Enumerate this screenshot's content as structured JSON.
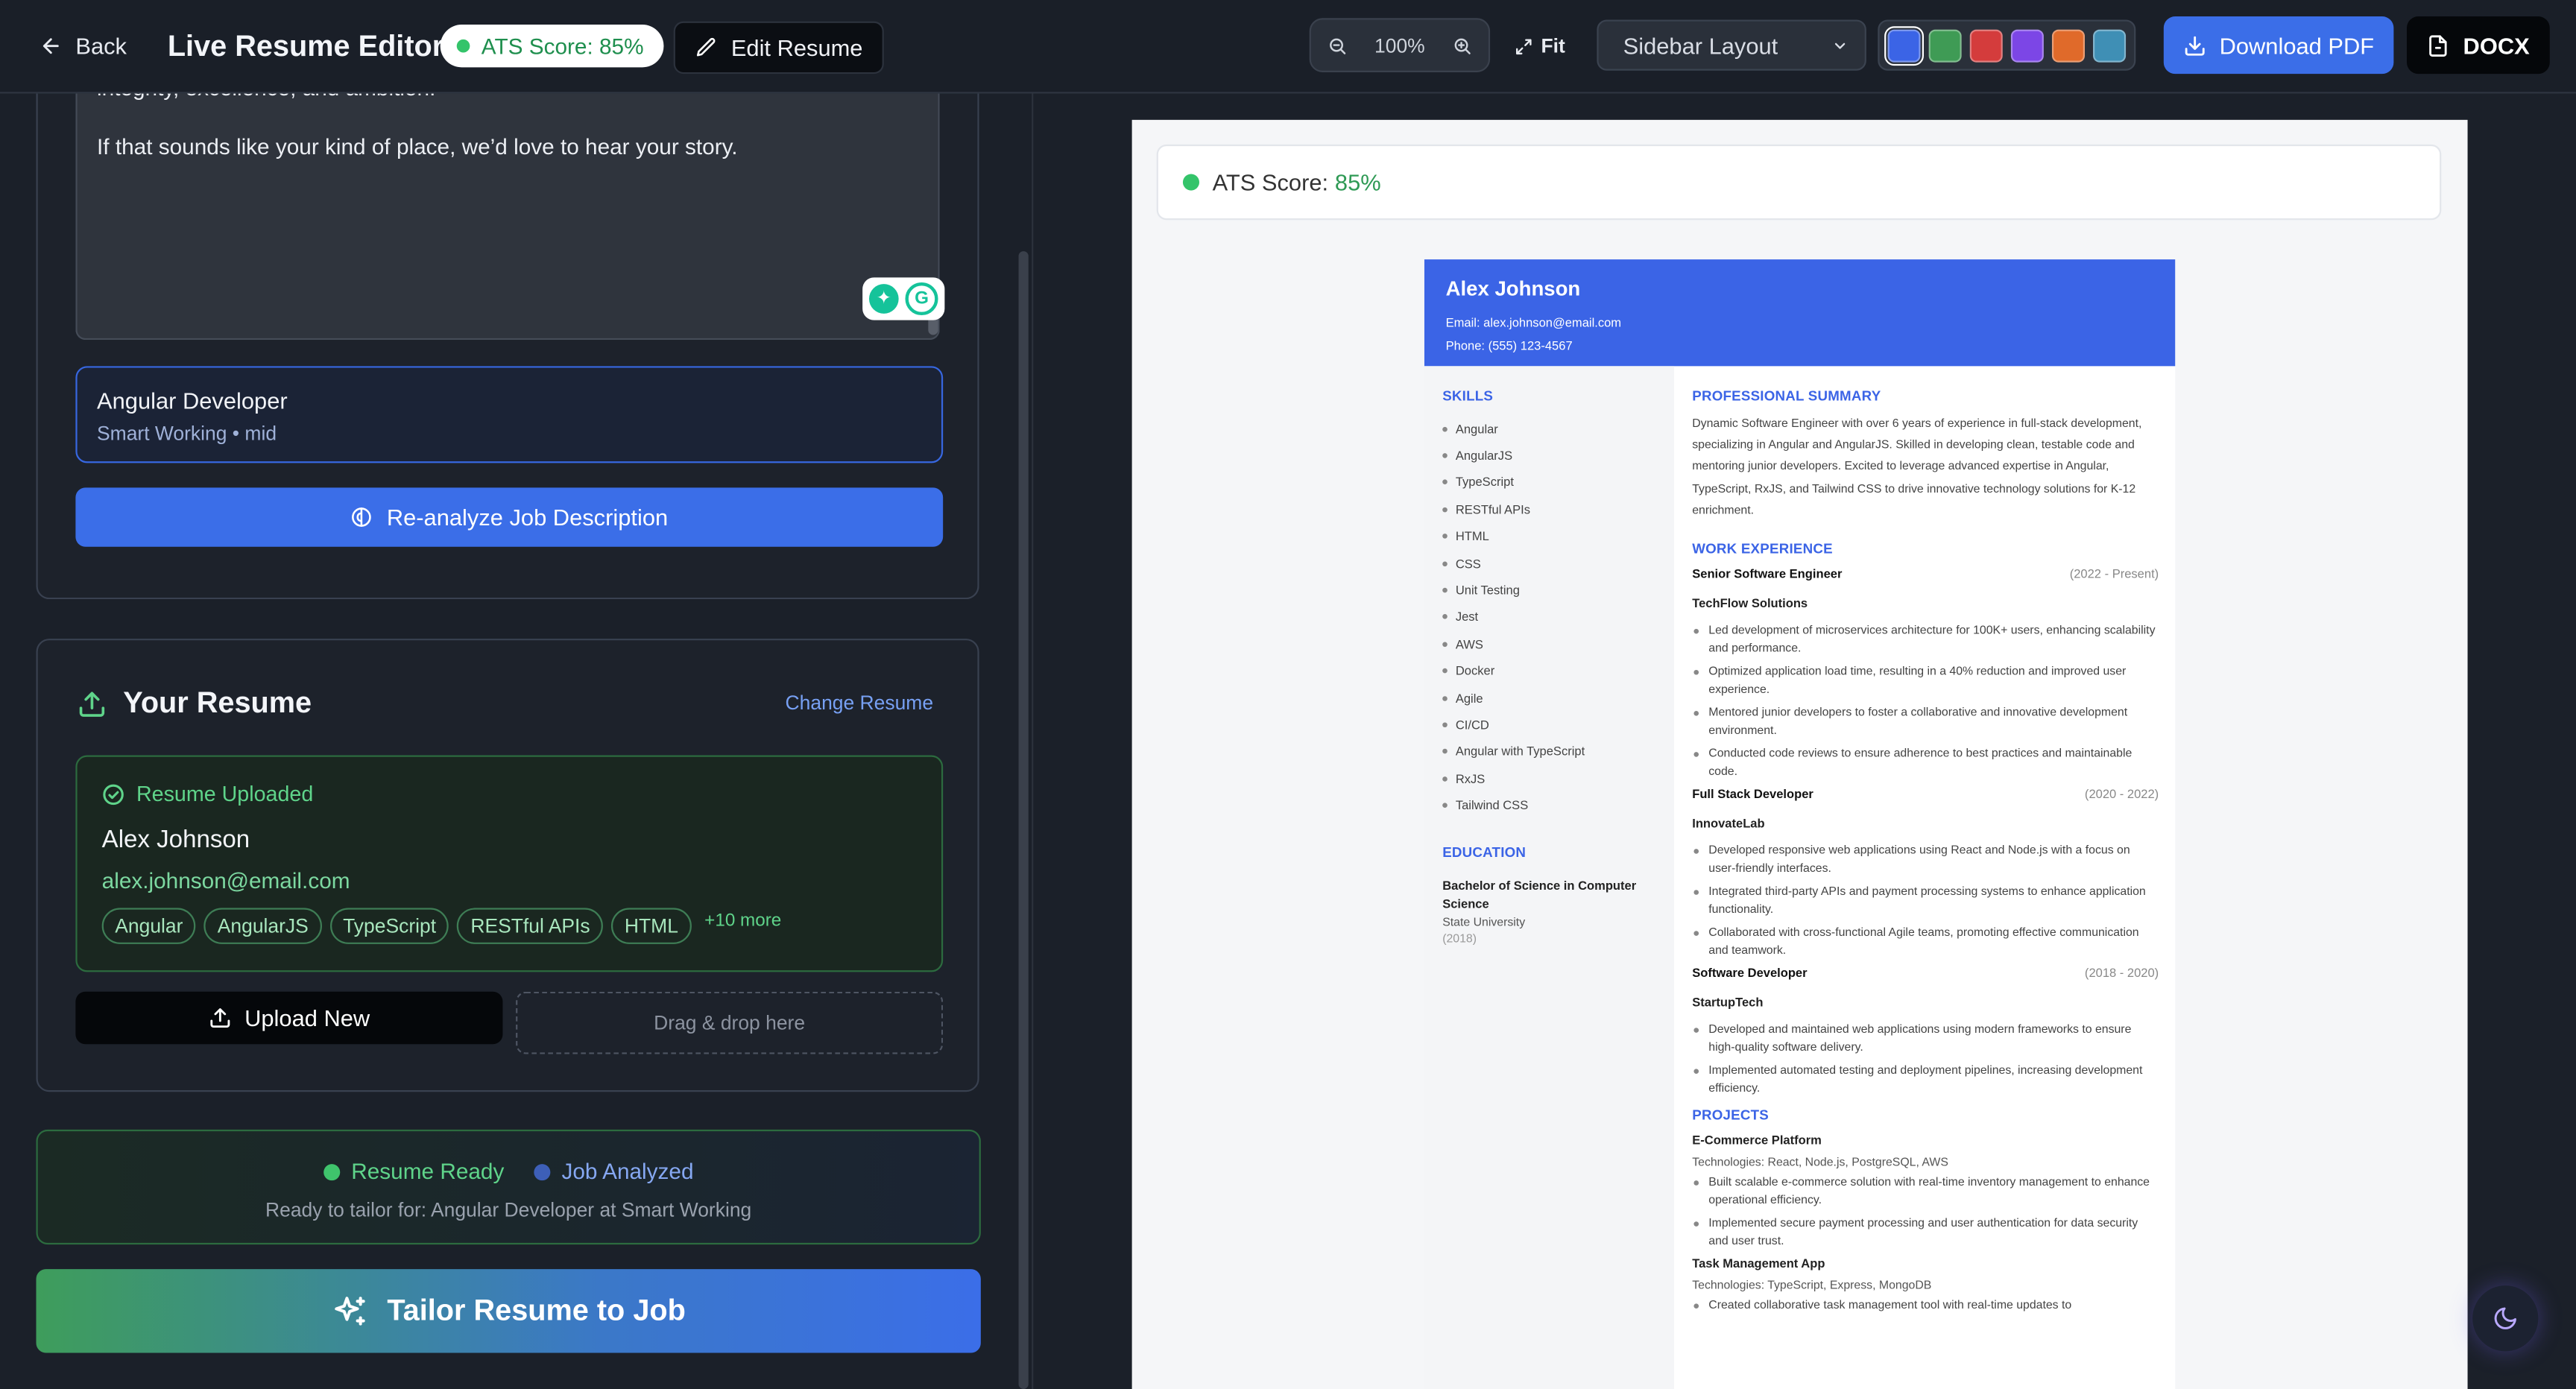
{
  "header": {
    "back_label": "Back",
    "title": "Live Resume Editor",
    "ats_pill": "ATS Score: 85%",
    "edit_label": "Edit Resume",
    "zoom": "100%",
    "fit_label": "Fit",
    "layout_select": "Sidebar Layout",
    "swatch_colors": [
      "#3b64e6",
      "#3f9b55",
      "#d43c3c",
      "#7c46e6",
      "#e06a2a",
      "#3f8fb5"
    ],
    "download_pdf_label": "Download PDF",
    "docx_label": "DOCX"
  },
  "job_panel": {
    "jd_lines": [
      "integrity, excellence, and ambition.",
      "If that sounds like your kind of place, we’d love to hear your story."
    ],
    "selected_job_title": "Angular Developer",
    "selected_job_meta": "Smart Working • mid",
    "reanalyze_label": "Re-analyze Job Description"
  },
  "resume_panel": {
    "heading": "Your Resume",
    "change_label": "Change Resume",
    "uploaded_status": "Resume Uploaded",
    "name": "Alex Johnson",
    "email": "alex.johnson@email.com",
    "skills": [
      "Angular",
      "AngularJS",
      "TypeScript",
      "RESTful APIs",
      "HTML"
    ],
    "more_label": "+10 more",
    "upload_new_label": "Upload New",
    "dropzone_label": "Drag & drop here"
  },
  "status": {
    "resume_ready": "Resume Ready",
    "job_analyzed": "Job Analyzed",
    "subtitle": "Ready to tailor for: Angular Developer at Smart Working"
  },
  "tailor_label": "Tailor Resume to Job",
  "preview": {
    "ats_label": "ATS Score:",
    "ats_value": "85%",
    "resume": {
      "name": "Alex Johnson",
      "email_line": "Email: alex.johnson@email.com",
      "phone_line": "Phone: (555) 123-4567",
      "skills_heading": "SKILLS",
      "skills": [
        "Angular",
        "AngularJS",
        "TypeScript",
        "RESTful APIs",
        "HTML",
        "CSS",
        "Unit Testing",
        "Jest",
        "AWS",
        "Docker",
        "Agile",
        "CI/CD",
        "Angular with TypeScript",
        "RxJS",
        "Tailwind CSS"
      ],
      "education_heading": "EDUCATION",
      "degree": "Bachelor of Science in Computer Science",
      "school": "State University",
      "grad_year": "(2018)",
      "summary_heading": "PROFESSIONAL SUMMARY",
      "summary": "Dynamic Software Engineer with over 6 years of experience in full-stack development, specializing in Angular and AngularJS. Skilled in developing clean, testable code and mentoring junior developers. Excited to leverage advanced expertise in Angular, TypeScript, RxJS, and Tailwind CSS to drive innovative technology solutions for K-12 enrichment.",
      "experience_heading": "WORK EXPERIENCE",
      "jobs": [
        {
          "title": "Senior Software Engineer",
          "dates": "(2022 - Present)",
          "company": "TechFlow Solutions",
          "bullets": [
            "Led development of microservices architecture for 100K+ users, enhancing scalability and performance.",
            "Optimized application load time, resulting in a 40% reduction and improved user experience.",
            "Mentored junior developers to foster a collaborative and innovative development environment.",
            "Conducted code reviews to ensure adherence to best practices and maintainable code."
          ]
        },
        {
          "title": "Full Stack Developer",
          "dates": "(2020 - 2022)",
          "company": "InnovateLab",
          "bullets": [
            "Developed responsive web applications using React and Node.js with a focus on user-friendly interfaces.",
            "Integrated third-party APIs and payment processing systems to enhance application functionality.",
            "Collaborated with cross-functional Agile teams, promoting effective communication and teamwork."
          ]
        },
        {
          "title": "Software Developer",
          "dates": "(2018 - 2020)",
          "company": "StartupTech",
          "bullets": [
            "Developed and maintained web applications using modern frameworks to ensure high-quality software delivery.",
            "Implemented automated testing and deployment pipelines, increasing development efficiency."
          ]
        }
      ],
      "projects_heading": "PROJECTS",
      "projects": [
        {
          "name": "E-Commerce Platform",
          "tech": "Technologies: React, Node.js, PostgreSQL, AWS",
          "bullets": [
            "Built scalable e-commerce solution with real-time inventory management to enhance operational efficiency.",
            "Implemented secure payment processing and user authentication for data security and user trust."
          ]
        },
        {
          "name": "Task Management App",
          "tech": "Technologies: TypeScript, Express, MongoDB",
          "bullets": [
            "Created collaborative task management tool with real-time updates to"
          ]
        }
      ]
    }
  }
}
